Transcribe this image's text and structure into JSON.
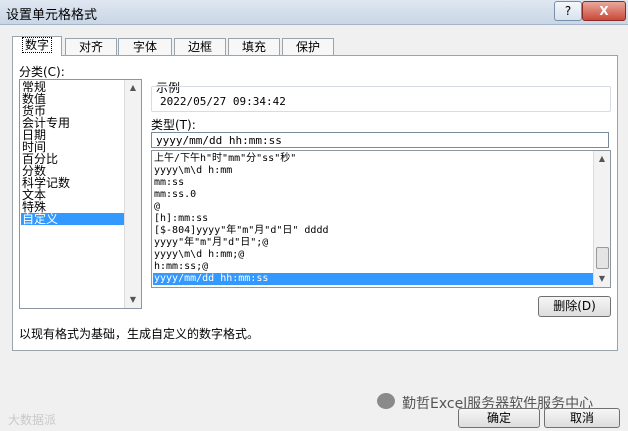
{
  "window": {
    "title": "设置单元格格式",
    "help_label": "?",
    "close_label": "X"
  },
  "tabs": [
    {
      "label": "数字"
    },
    {
      "label": "对齐"
    },
    {
      "label": "字体"
    },
    {
      "label": "边框"
    },
    {
      "label": "填充"
    },
    {
      "label": "保护"
    }
  ],
  "category": {
    "label": "分类(C):",
    "items": [
      "常规",
      "数值",
      "货币",
      "会计专用",
      "日期",
      "时间",
      "百分比",
      "分数",
      "科学记数",
      "文本",
      "特殊",
      "自定义"
    ],
    "selected": "自定义"
  },
  "sample": {
    "label": "示例",
    "value": "2022/05/27 09:34:42"
  },
  "type": {
    "label": "类型(T):",
    "value": "yyyy/mm/dd hh:mm:ss",
    "items": [
      "上午/下午h\"时\"mm\"分\"ss\"秒\"",
      "yyyy\\m\\d h:mm",
      "mm:ss",
      "mm:ss.0",
      "@",
      "[h]:mm:ss",
      "[$-804]yyyy\"年\"m\"月\"d\"日\" dddd",
      "yyyy\"年\"m\"月\"d\"日\";@",
      "yyyy\\m\\d h:mm;@",
      "h:mm:ss;@",
      "yyyy/mm/dd hh:mm:ss"
    ],
    "selected": "yyyy/mm/dd hh:mm:ss"
  },
  "delete_label": "删除(D)",
  "description": "以现有格式为基础，生成自定义的数字格式。",
  "ok_label": "确定",
  "cancel_label": "取消",
  "watermark_left": "大数据派",
  "watermark_right": "勤哲Excel服务器软件服务中心"
}
